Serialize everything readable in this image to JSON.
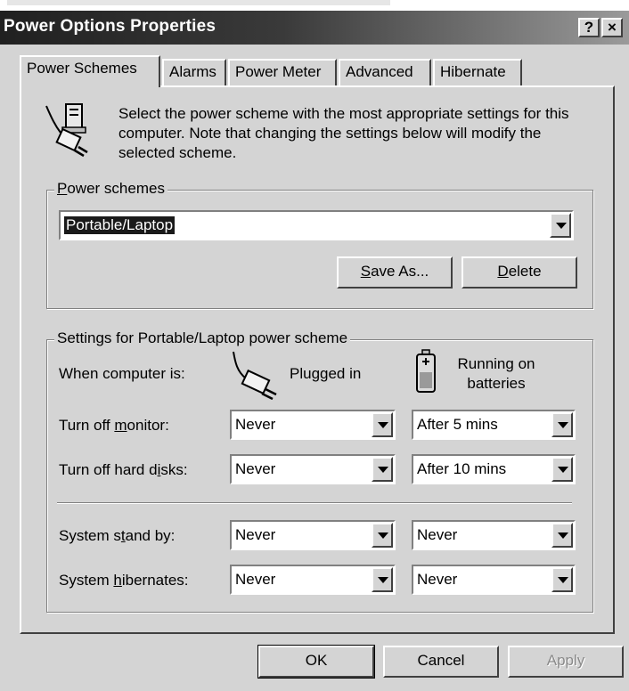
{
  "window": {
    "title": "Power Options Properties",
    "help_label": "?",
    "close_label": "×"
  },
  "tabs": [
    {
      "label": "Power Schemes",
      "active": true
    },
    {
      "label": "Alarms"
    },
    {
      "label": "Power Meter"
    },
    {
      "label": "Advanced"
    },
    {
      "label": "Hibernate"
    }
  ],
  "intro": {
    "icon": "power-plug-computer-icon",
    "text": "Select the power scheme with the most appropriate settings for this computer. Note that changing the settings below will modify the selected scheme."
  },
  "power_schemes": {
    "group_label_pre": "",
    "group_label_u": "P",
    "group_label_post": "ower schemes",
    "selected": "Portable/Laptop",
    "save_as_u": "S",
    "save_as_rest": "ave As...",
    "delete_u": "D",
    "delete_rest": "elete"
  },
  "settings": {
    "group_label": "Settings for Portable/Laptop power scheme",
    "when_label": "When computer is:",
    "plugged_in_label": "Plugged in",
    "batteries_label_line1": "Running on",
    "batteries_label_line2": "batteries",
    "rows": [
      {
        "label_pre": "Turn off ",
        "label_u": "m",
        "label_post": "onitor:",
        "plugged": "Never",
        "battery": "After 5 mins"
      },
      {
        "label_pre": "Turn off hard d",
        "label_u": "i",
        "label_post": "sks:",
        "plugged": "Never",
        "battery": "After 10 mins"
      },
      {
        "label_pre": "System s",
        "label_u": "t",
        "label_post": "and by:",
        "plugged": "Never",
        "battery": "Never"
      },
      {
        "label_pre": "System ",
        "label_u": "h",
        "label_post": "ibernates:",
        "plugged": "Never",
        "battery": "Never"
      }
    ]
  },
  "footer": {
    "ok_label": "OK",
    "cancel_label": "Cancel",
    "apply_label": "Apply"
  }
}
